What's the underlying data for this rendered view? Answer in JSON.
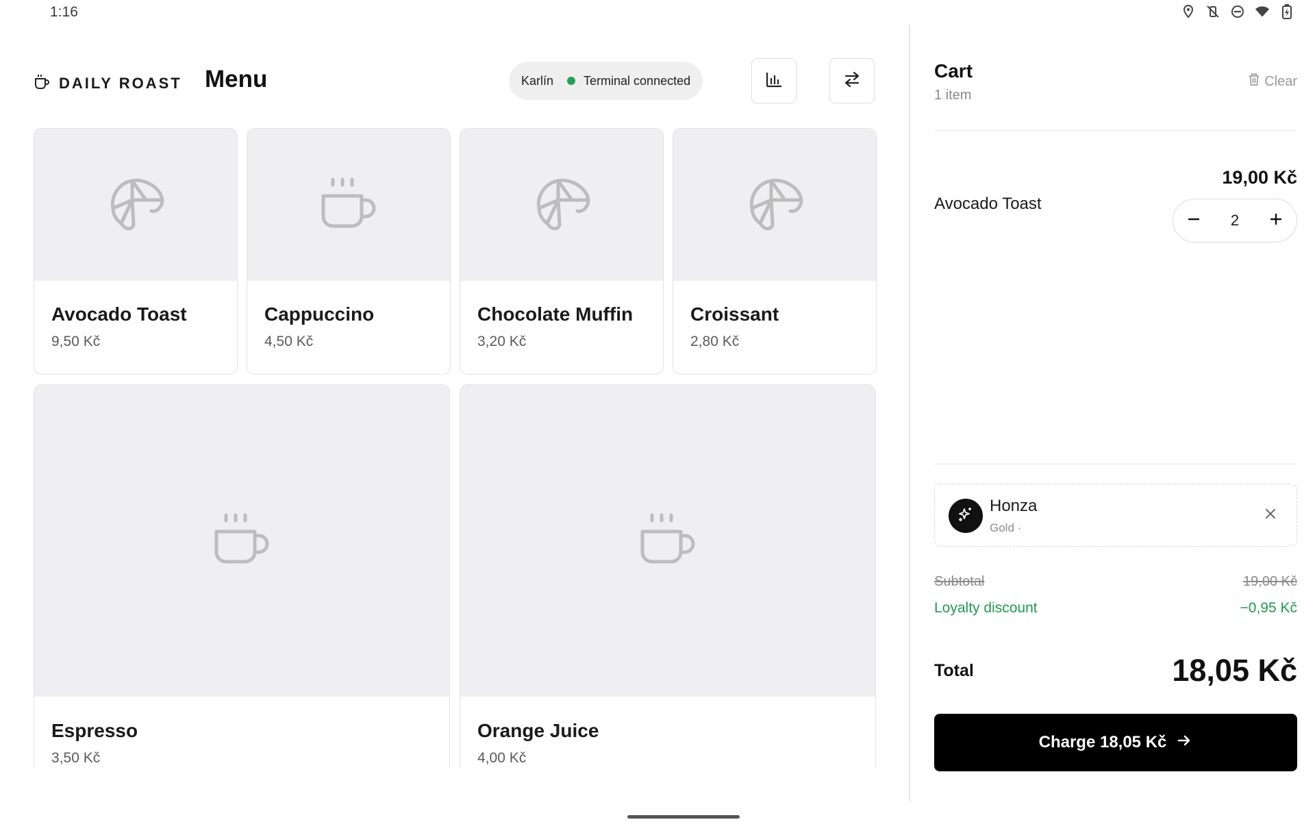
{
  "status_bar": {
    "time": "1:16",
    "icons": [
      "location-icon",
      "vibrate-off-icon",
      "do-not-disturb-icon",
      "wifi-icon",
      "battery-charging-icon"
    ]
  },
  "header": {
    "brand": "DAILY ROAST",
    "brand_icon": "coffee-cup-icon",
    "title": "Menu",
    "location": "Karlín",
    "terminal_status": "Terminal connected",
    "status_color": "#22a356",
    "report_icon": "bar-chart-icon",
    "switch_icon": "swap-arrows-icon"
  },
  "menu": {
    "items": [
      {
        "name": "Avocado Toast",
        "price": "9,50 Kč",
        "icon": "croissant-icon"
      },
      {
        "name": "Cappuccino",
        "price": "4,50 Kč",
        "icon": "coffee-cup-icon"
      },
      {
        "name": "Chocolate Muffin",
        "price": "3,20 Kč",
        "icon": "croissant-icon"
      },
      {
        "name": "Croissant",
        "price": "2,80 Kč",
        "icon": "croissant-icon"
      },
      {
        "name": "Espresso",
        "price": "3,50 Kč",
        "icon": "coffee-cup-icon"
      },
      {
        "name": "Orange Juice",
        "price": "4,00 Kč",
        "icon": "coffee-cup-icon"
      }
    ]
  },
  "cart": {
    "title": "Cart",
    "count": "1 item",
    "clear_label": "Clear",
    "line_items": [
      {
        "name": "Avocado Toast",
        "price": "19,00 Kč",
        "qty": "2"
      }
    ],
    "customer": {
      "name": "Honza",
      "tier": "Gold ·"
    },
    "subtotal_label": "Subtotal",
    "subtotal_value": "19,00 Kč",
    "discount_label": "Loyalty discount",
    "discount_value": "−0,95 Kč",
    "total_label": "Total",
    "total_value": "18,05 Kč",
    "charge_label": "Charge 18,05 Kč",
    "accent_color": "#000000",
    "discount_color": "#1f9b4e"
  }
}
